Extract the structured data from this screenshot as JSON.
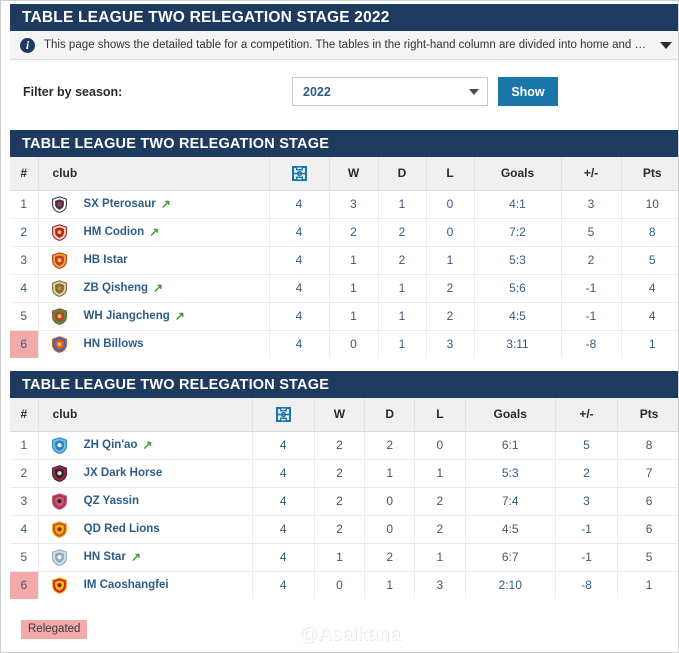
{
  "page": {
    "title": "TABLE LEAGUE TWO RELEGATION STAGE 2022",
    "info_text": "This page shows the detailed table for a competition. The tables in the right-hand column are divided into home and away games. Two additio...",
    "info_icon": "info-circle-icon",
    "info_chevron_icon": "chevron-down-icon"
  },
  "filter": {
    "label": "Filter by season:",
    "season_value": "2022",
    "season_placeholder": "2022",
    "caret_icon": "chevron-down-icon",
    "show_label": "Show"
  },
  "columns": {
    "rank": "#",
    "club": "club",
    "matches_icon": "football-pitch-icon",
    "w": "W",
    "d": "D",
    "l": "L",
    "goals": "Goals",
    "diff": "+/-",
    "pts": "Pts"
  },
  "colors": {
    "header_navy": "#1f3a5f",
    "accent_blue": "#1a76a8",
    "link_blue": "#2c5d87",
    "relegated_pink": "#f2a9a9",
    "promotion_green": "#3f9a33"
  },
  "tables": [
    {
      "title": "TABLE LEAGUE TWO RELEGATION STAGE",
      "rows": [
        {
          "rank": "1",
          "club": "SX Pterosaur",
          "arrow": "↗",
          "matches": "4",
          "w": "3",
          "d": "1",
          "l": "0",
          "goals": "4:1",
          "diff": "3",
          "pts": "10",
          "relegated": false,
          "crest": "crest-sx-pterosaur"
        },
        {
          "rank": "2",
          "club": "HM Codion",
          "arrow": "↗",
          "matches": "4",
          "w": "2",
          "d": "2",
          "l": "0",
          "goals": "7:2",
          "diff": "5",
          "pts": "8",
          "relegated": false,
          "crest": "crest-hm-codion"
        },
        {
          "rank": "3",
          "club": "HB Istar",
          "arrow": "",
          "matches": "4",
          "w": "1",
          "d": "2",
          "l": "1",
          "goals": "5:3",
          "diff": "2",
          "pts": "5",
          "relegated": false,
          "crest": "crest-hb-istar"
        },
        {
          "rank": "4",
          "club": "ZB Qisheng",
          "arrow": "↗",
          "matches": "4",
          "w": "1",
          "d": "1",
          "l": "2",
          "goals": "5:6",
          "diff": "-1",
          "pts": "4",
          "relegated": false,
          "crest": "crest-zb-qisheng"
        },
        {
          "rank": "5",
          "club": "WH Jiangcheng",
          "arrow": "↗",
          "matches": "4",
          "w": "1",
          "d": "1",
          "l": "2",
          "goals": "4:5",
          "diff": "-1",
          "pts": "4",
          "relegated": false,
          "crest": "crest-wh-jiangcheng"
        },
        {
          "rank": "6",
          "club": "HN Billows",
          "arrow": "",
          "matches": "4",
          "w": "0",
          "d": "1",
          "l": "3",
          "goals": "3:11",
          "diff": "-8",
          "pts": "1",
          "relegated": true,
          "crest": "crest-hn-billows"
        }
      ]
    },
    {
      "title": "TABLE LEAGUE TWO RELEGATION STAGE",
      "rows": [
        {
          "rank": "1",
          "club": "ZH Qin'ao",
          "arrow": "↗",
          "matches": "4",
          "w": "2",
          "d": "2",
          "l": "0",
          "goals": "6:1",
          "diff": "5",
          "pts": "8",
          "relegated": false,
          "crest": "crest-zh-qinao"
        },
        {
          "rank": "2",
          "club": "JX Dark Horse",
          "arrow": "",
          "matches": "4",
          "w": "2",
          "d": "1",
          "l": "1",
          "goals": "5:3",
          "diff": "2",
          "pts": "7",
          "relegated": false,
          "crest": "crest-jx-dark-horse"
        },
        {
          "rank": "3",
          "club": "QZ Yassin",
          "arrow": "",
          "matches": "4",
          "w": "2",
          "d": "0",
          "l": "2",
          "goals": "7:4",
          "diff": "3",
          "pts": "6",
          "relegated": false,
          "crest": "crest-qz-yassin"
        },
        {
          "rank": "4",
          "club": "QD Red Lions",
          "arrow": "",
          "matches": "4",
          "w": "2",
          "d": "0",
          "l": "2",
          "goals": "4:5",
          "diff": "-1",
          "pts": "6",
          "relegated": false,
          "crest": "crest-qd-red-lions"
        },
        {
          "rank": "5",
          "club": "HN Star",
          "arrow": "↗",
          "matches": "4",
          "w": "1",
          "d": "2",
          "l": "1",
          "goals": "6:7",
          "diff": "-1",
          "pts": "5",
          "relegated": false,
          "crest": "crest-hn-star"
        },
        {
          "rank": "6",
          "club": "IM Caoshangfei",
          "arrow": "",
          "matches": "4",
          "w": "0",
          "d": "1",
          "l": "3",
          "goals": "2:10",
          "diff": "-8",
          "pts": "1",
          "relegated": true,
          "crest": "crest-im-caoshangfei"
        }
      ]
    }
  ],
  "legend": {
    "relegated_label": "Relegated"
  },
  "watermark": {
    "handle": "@Asaikana",
    "icon": "weibo-logo-icon"
  }
}
